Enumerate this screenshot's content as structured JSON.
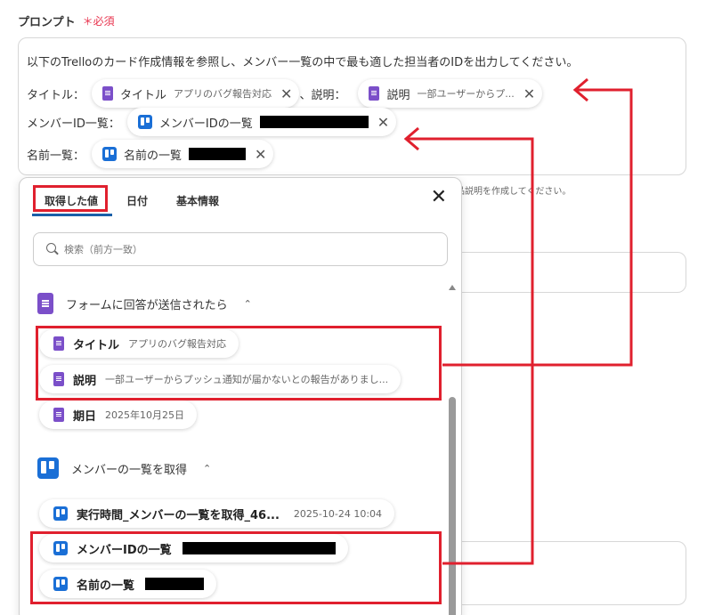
{
  "field": {
    "title": "プロンプト",
    "required": "＊必須"
  },
  "prompt": {
    "line1": "以下のTrelloのカード作成情報を参照し、メンバー一覧の中で最も適した担当者のIDを出力してください。",
    "title_label": "タイトル：",
    "title_chip": {
      "name": "タイトル",
      "value": "アプリのバグ報告対応"
    },
    "desc_label": "、説明：",
    "desc_chip": {
      "name": "説明",
      "value": "一部ユーザーからプ..."
    },
    "member_label": "メンバーID一覧：",
    "member_chip": {
      "name": "メンバーIDの一覧"
    },
    "names_label": "名前一覧：",
    "names_chip": {
      "name": "名前の一覧"
    }
  },
  "behind_hint": "品説明を作成してください。",
  "panel": {
    "tabs": [
      "取得した値",
      "日付",
      "基本情報"
    ],
    "close": "✕",
    "search_placeholder": "検索（前方一致）",
    "section1": {
      "title": "フォームに回答が送信されたら",
      "chevron": "⌃"
    },
    "items1": [
      {
        "name": "タイトル",
        "value": "アプリのバグ報告対応"
      },
      {
        "name": "説明",
        "value": "一部ユーザーからプッシュ通知が届かないとの報告がありまし..."
      },
      {
        "name": "期日",
        "value": "2025年10月25日"
      }
    ],
    "section2": {
      "title": "メンバーの一覧を取得",
      "chevron": "⌃"
    },
    "items2": [
      {
        "name": "実行時間_メンバーの一覧を取得_46...",
        "value": "2025-10-24 10:04"
      },
      {
        "name": "メンバーIDの一覧",
        "value": ""
      },
      {
        "name": "名前の一覧",
        "value": ""
      }
    ]
  },
  "icons": {
    "close": "close-icon",
    "search": "search-icon",
    "form": "form-icon",
    "trello": "trello-icon"
  },
  "colors": {
    "accent_red": "#e0202e",
    "required_red": "#e8344e",
    "form_purple": "#7b4fc9",
    "trello_blue": "#1a6fd6",
    "tab_underline": "#1a5fa8"
  }
}
